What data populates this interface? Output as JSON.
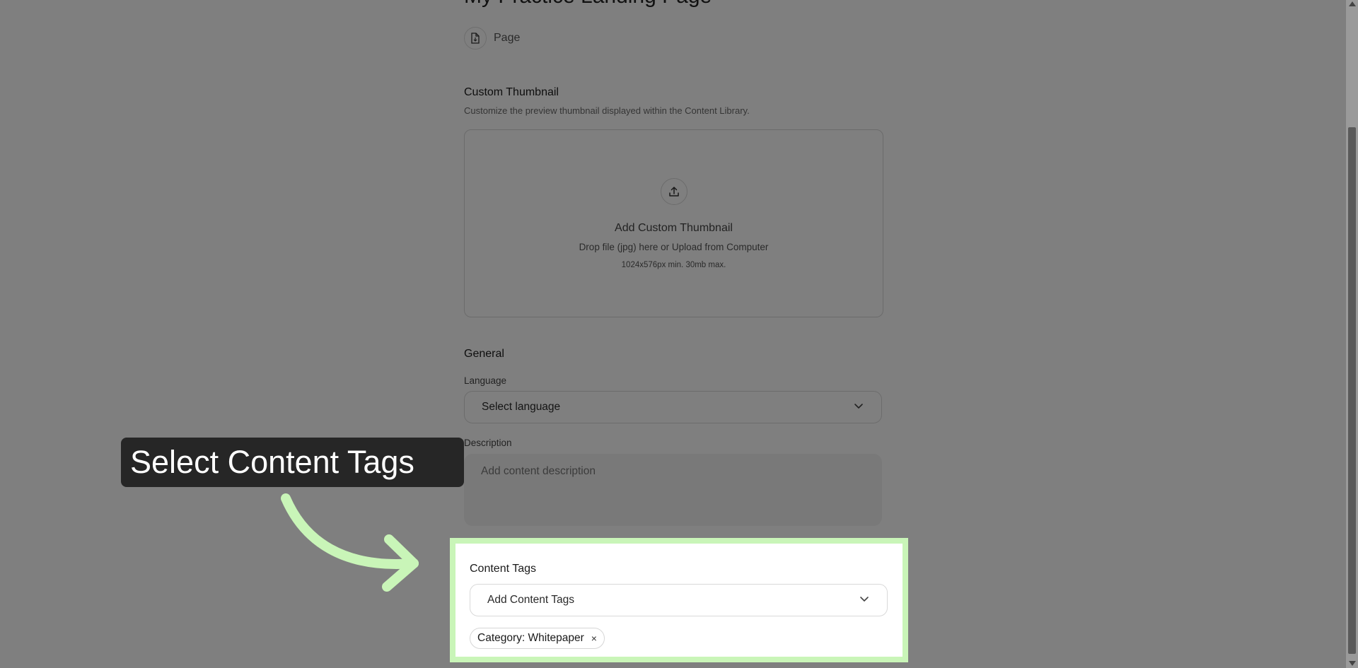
{
  "header": {
    "title": "My Practice Landing Page",
    "type_label": "Page",
    "type_icon": "document-icon"
  },
  "thumbnail": {
    "section_title": "Custom Thumbnail",
    "section_sub": "Customize the preview thumbnail displayed within the Content Library.",
    "dz_title": "Add Custom Thumbnail",
    "dz_sub": "Drop file (jpg) here or Upload from Computer",
    "dz_note": "1024x576px min. 30mb max.",
    "icon": "upload-icon"
  },
  "general": {
    "section_title": "General",
    "language_label": "Language",
    "language_value": "Select language",
    "description_label": "Description",
    "description_placeholder": "Add content description"
  },
  "tags": {
    "section_title": "Content Tags",
    "select_placeholder": "Add Content Tags",
    "chips": [
      {
        "label": "Category: Whitepaper",
        "remove": "×"
      }
    ]
  },
  "callout": {
    "text": "Select Content Tags"
  },
  "colors": {
    "highlight": "#c9f5b8",
    "callout_bg": "#262626",
    "overlay": "rgba(0,0,0,0.5)"
  }
}
